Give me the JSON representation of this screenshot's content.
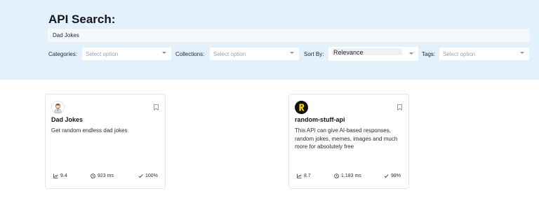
{
  "search": {
    "heading": "API Search:",
    "query": "Dad Jokes"
  },
  "filters": {
    "categories_label": "Categories:",
    "categories_placeholder": "Select option",
    "collections_label": "Collections:",
    "collections_placeholder": "Select option",
    "sort_label": "Sort By:",
    "sort_value": "Relevance",
    "tags_label": "Tags:",
    "tags_placeholder": "Select option"
  },
  "results": [
    {
      "title": "Dad Jokes",
      "description": "Get random endless dad jokes",
      "popularity": "9.4",
      "latency": "923 ms",
      "success_rate": "100%",
      "logo": "dad-face-icon"
    },
    {
      "title": "random-stuff-api",
      "description": "This API can give AI-based responses, random jokes, memes, images and much more for absolutely free",
      "popularity": "8.7",
      "latency": "1,183 ms",
      "success_rate": "98%",
      "logo": "r-letter-logo"
    }
  ],
  "colors": {
    "panel_bg": "#e3f1fc",
    "logo_dark": "#111111",
    "logo_accent": "#f2d31b"
  }
}
